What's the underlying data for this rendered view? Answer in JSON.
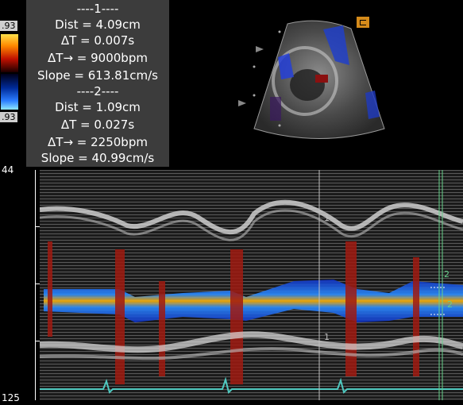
{
  "measurements": {
    "group1": {
      "header": "----1----",
      "dist": "Dist = 4.09cm",
      "dt": "ΔT = 0.007s",
      "rate": "ΔT→ = 9000bpm",
      "slope": "Slope = 613.81cm/s"
    },
    "group2": {
      "header": "----2----",
      "dist": "Dist = 1.09cm",
      "dt": "ΔT = 0.027s",
      "rate": "ΔT→ = 2250bpm",
      "slope": "Slope = 40.99cm/s"
    }
  },
  "color_scale": {
    "top_value": ".93",
    "bottom_value": ".93"
  },
  "depth_axis": {
    "top_label": "44",
    "bottom_label": "125"
  },
  "calipers": {
    "marker1": "1",
    "marker2": "2"
  },
  "colors": {
    "panel": "#3c3c3c",
    "ecg": "#4fc9c0",
    "caliper": "#bfbfbf",
    "caliper2": "#66d08a"
  },
  "icons": {
    "probe_orientation": "orientation-marker-icon"
  }
}
